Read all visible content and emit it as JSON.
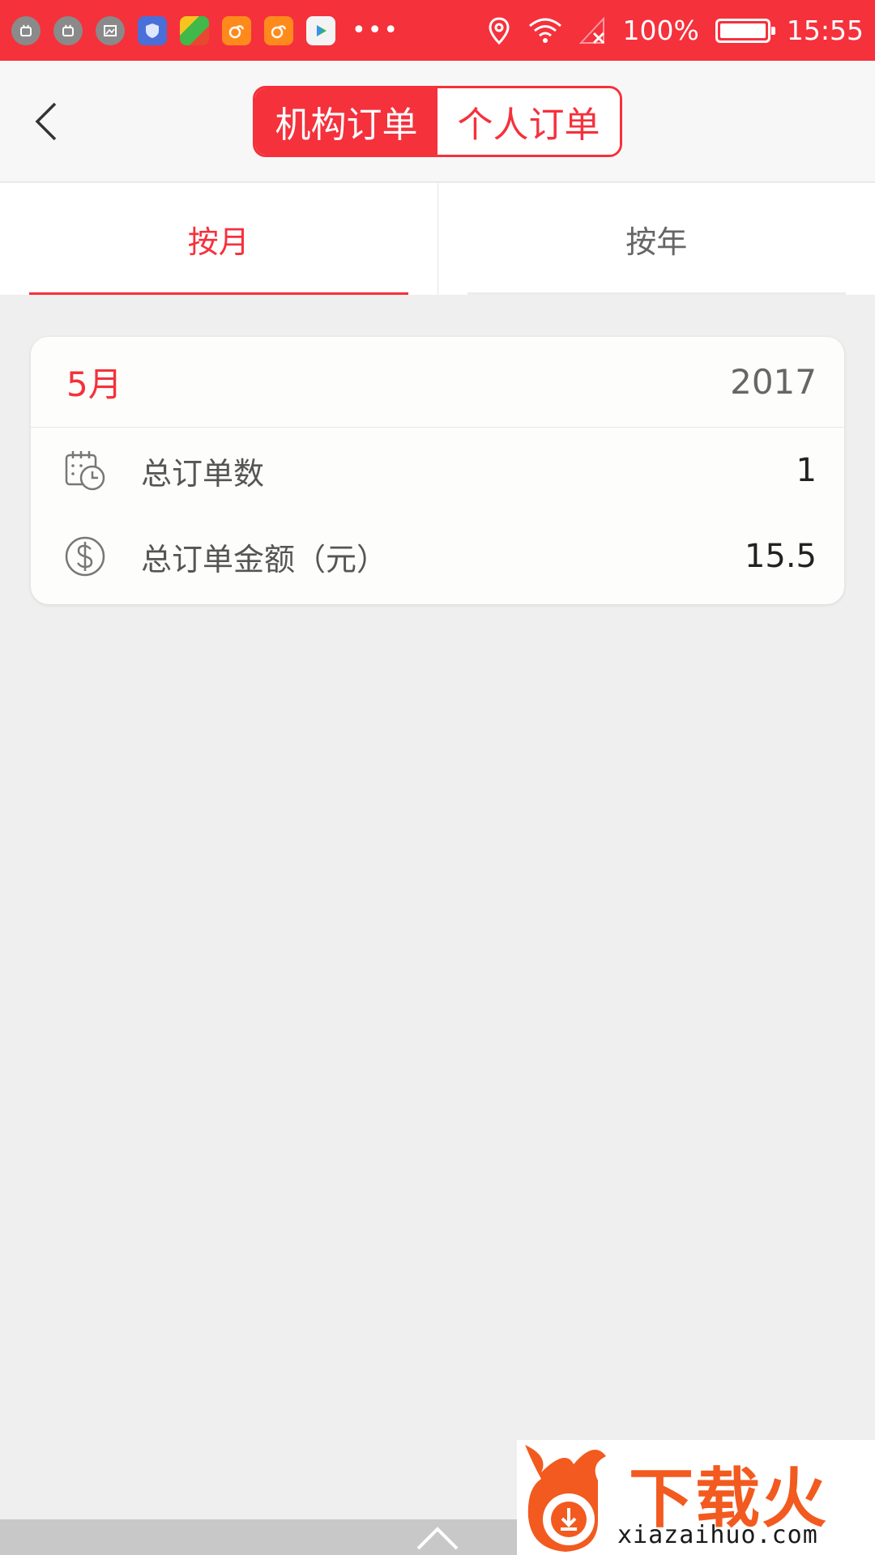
{
  "status_bar": {
    "battery": "100%",
    "time": "15:55",
    "battery_level": 1.0
  },
  "segment": {
    "options": [
      "机构订单",
      "个人订单"
    ],
    "selected": 0
  },
  "tabs": [
    {
      "label": "按月",
      "active": true
    },
    {
      "label": "按年",
      "active": false
    }
  ],
  "card": {
    "month": "5月",
    "year": "2017",
    "rows": [
      {
        "label": "总订单数",
        "value": "1",
        "icon": "calendar-clock-icon"
      },
      {
        "label": "总订单金额（元）",
        "value": "15.5",
        "icon": "dollar-coin-icon"
      }
    ]
  },
  "watermark": {
    "logo_text": "下载火",
    "url": "xiazaihuo.com"
  },
  "colors": {
    "accent": "#f5313c",
    "background": "#efefef"
  }
}
